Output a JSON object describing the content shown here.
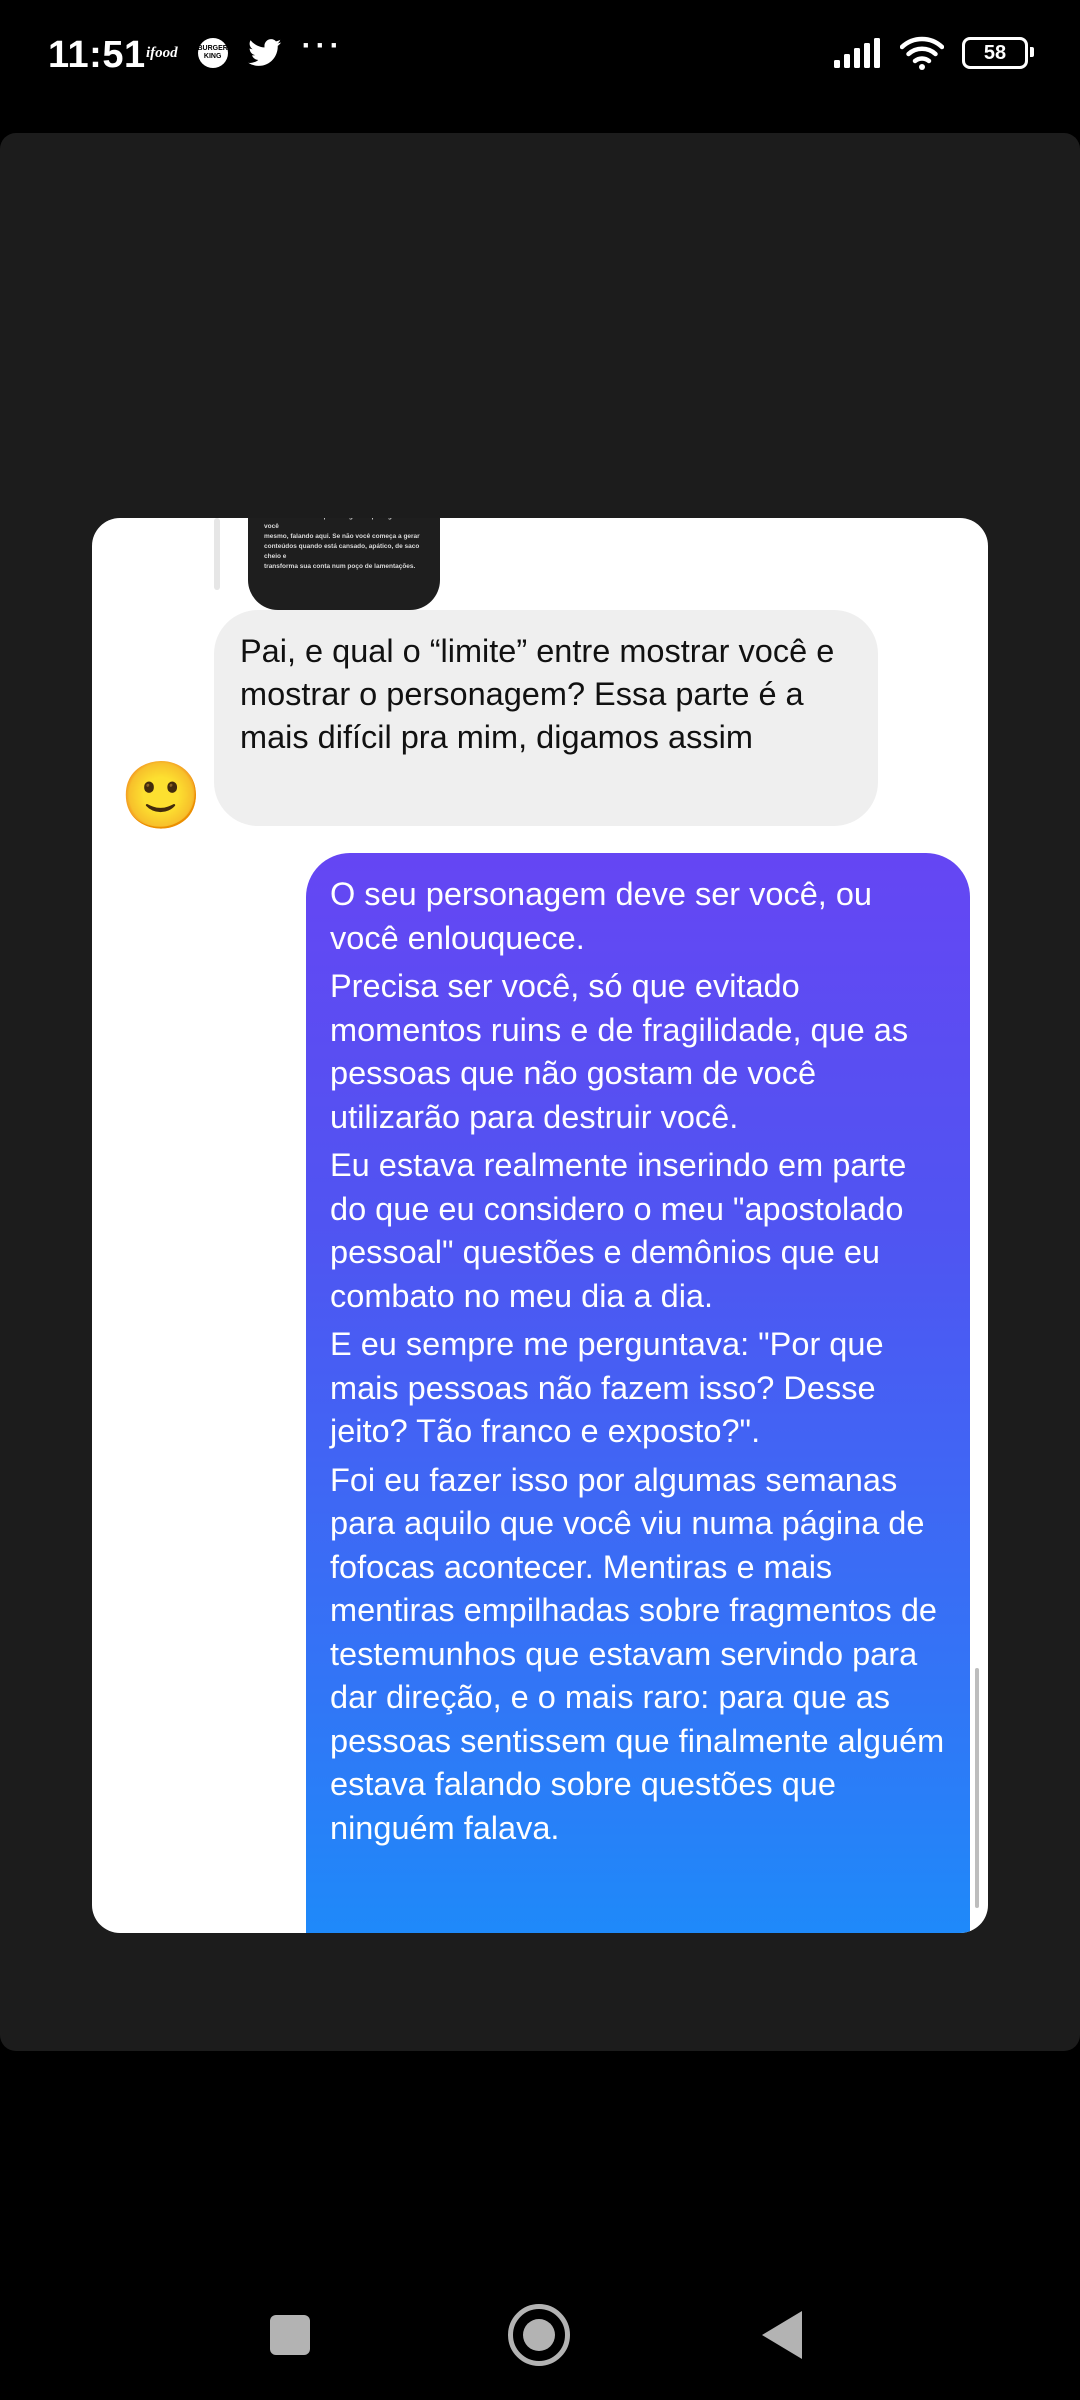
{
  "status_bar": {
    "time": "11:51",
    "ifood_label": "ifood",
    "bk_label": "BURGER KING",
    "more_label": "···",
    "battery": "58"
  },
  "chat": {
    "preview_lines": [
      "acontecendo ali. O personagem te protege do ser você",
      "mesmo, falando aqui. Se não você começa a gerar",
      "conteúdos quando está cansado, apático, de saco cheio e",
      "transforma sua conta num poço de lamentações."
    ],
    "avatar_emoji": "🙂",
    "received_message": "Pai, e qual o “limite” entre mostrar você e mostrar o personagem? Essa parte é a mais difícil pra mim, digamos assim",
    "sent_paragraphs": [
      "O seu personagem deve ser você, ou você enlouquece.",
      "Precisa ser você, só que evitado momentos ruins e de fragilidade, que as pessoas que não gostam de você utilizarão para destruir você.",
      "Eu estava realmente inserindo em parte do que eu considero o meu \"apostolado pessoal\" questões e demônios que eu combato no meu dia a dia.",
      "E eu sempre me perguntava: \"Por que mais pessoas não fazem isso? Desse jeito? Tão franco e exposto?\".",
      "Foi eu fazer isso por algumas semanas para aquilo que você viu numa página de fofocas acontecer. Mentiras e mais mentiras empilhadas sobre fragmentos de testemunhos que estavam servindo para dar direção, e o mais raro: para que as pessoas sentissem que finalmente alguém estava falando sobre questões que ninguém falava."
    ],
    "colors": {
      "gradient_top": "#6546f3",
      "gradient_bottom": "#1c8cfa",
      "received_bg": "#efefef"
    }
  },
  "nav_bar": {
    "icons": [
      "square-recent-icon",
      "circle-home-icon",
      "triangle-back-icon"
    ]
  }
}
